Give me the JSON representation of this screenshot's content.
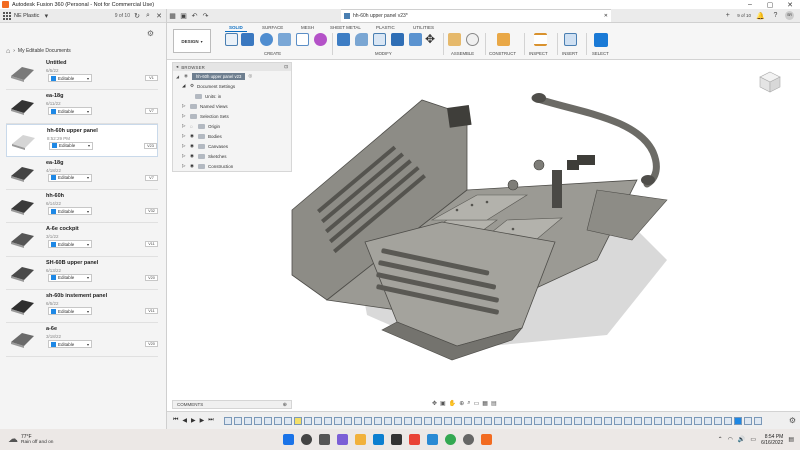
{
  "window": {
    "title": "Autodesk Fusion 360 (Personal - Not for Commercial Use)",
    "minimize": "–",
    "maximize": "▢",
    "close": "✕"
  },
  "data_panel": {
    "project": "NE Plastic",
    "count": "9 of 10",
    "breadcrumb": "My Editable Documents",
    "items": [
      {
        "name": "Untitled",
        "date": "6/5/22",
        "state": "Editable",
        "version": "V1"
      },
      {
        "name": "ea-18g",
        "date": "6/11/22",
        "state": "Editable",
        "version": "V7"
      },
      {
        "name": "hh-60h upper panel",
        "date": "8:52:29 PM",
        "state": "Editable",
        "version": "V23"
      },
      {
        "name": "ea-18g",
        "date": "4/18/22",
        "state": "Editable",
        "version": "V7"
      },
      {
        "name": "hh-60h",
        "date": "6/14/22",
        "state": "Editable",
        "version": "V32"
      },
      {
        "name": "A-6e cockpit",
        "date": "3/1/22",
        "state": "Editable",
        "version": "V11"
      },
      {
        "name": "SH-60B upper panel",
        "date": "6/13/22",
        "state": "Editable",
        "version": "V20"
      },
      {
        "name": "sh-60b instement panel",
        "date": "6/5/22",
        "state": "Editable",
        "version": "V11"
      },
      {
        "name": "a-6e",
        "date": "3/18/22",
        "state": "Editable",
        "version": "V20"
      }
    ]
  },
  "tabs_bar": {
    "doc_title": "hh-60h upper panel v23*",
    "count": "9 of 10",
    "avatar": "SR"
  },
  "ribbon": {
    "workspace": "DESIGN",
    "tabs": [
      "SOLID",
      "SURFACE",
      "MESH",
      "SHEET METAL",
      "PLASTIC",
      "UTILITIES"
    ],
    "groups": [
      "CREATE",
      "MODIFY",
      "ASSEMBLE",
      "CONSTRUCT",
      "INSPECT",
      "INSERT",
      "SELECT"
    ]
  },
  "browser": {
    "header": "BROWSER",
    "root": "hh-60h upper panel v23",
    "items": [
      {
        "label": "Document Settings"
      },
      {
        "label": "Units: in"
      },
      {
        "label": "Named Views"
      },
      {
        "label": "Selection Sets"
      },
      {
        "label": "Origin"
      },
      {
        "label": "Bodies"
      },
      {
        "label": "Canvases"
      },
      {
        "label": "Sketches"
      },
      {
        "label": "Construction"
      }
    ]
  },
  "comments": {
    "label": "COMMENTS"
  },
  "taskbar": {
    "temp": "77°F",
    "condition": "Rain off and on",
    "time": "8:54 PM",
    "date": "6/16/2022"
  },
  "colors": {
    "accent": "#0a6dc2",
    "model": "#8a8983",
    "model_dark": "#55544f"
  }
}
